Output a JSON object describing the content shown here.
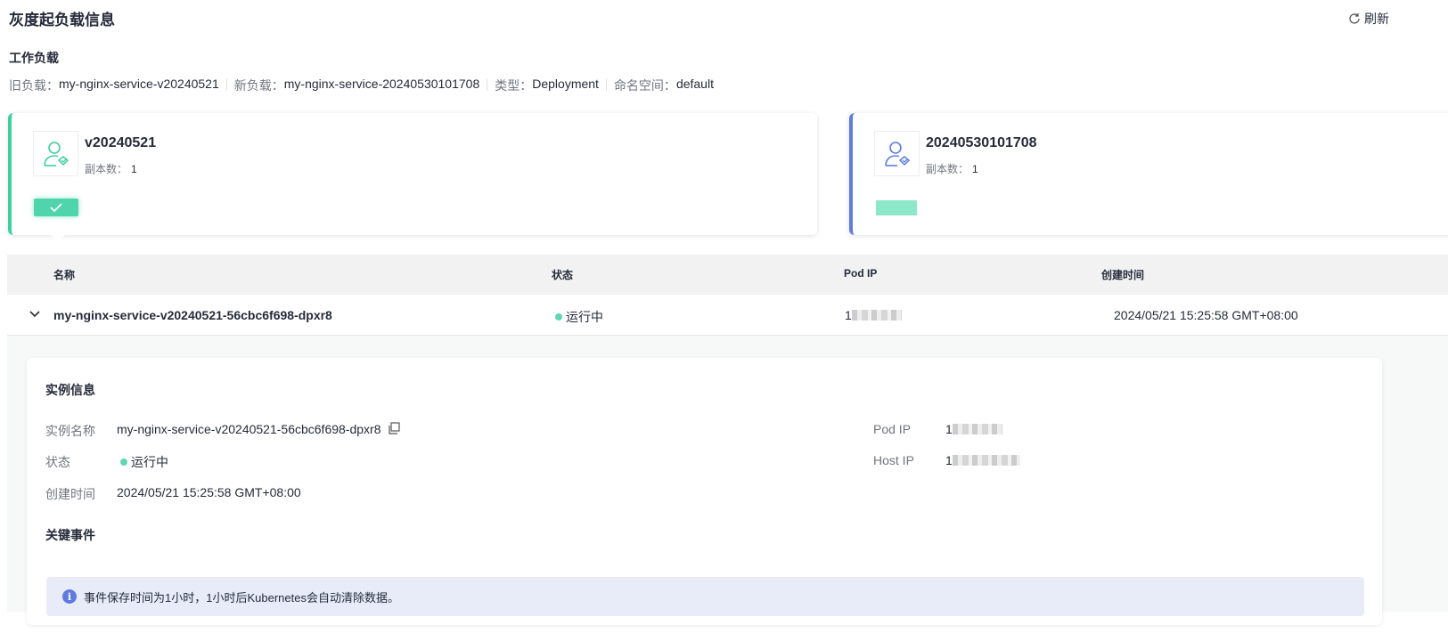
{
  "title": "灰度起负载信息",
  "refresh_label": "刷新",
  "workload": {
    "heading": "工作负载",
    "old_label": "旧负载：",
    "old_value": "my-nginx-service-v20240521",
    "new_label": "新负载：",
    "new_value": "my-nginx-service-20240530101708",
    "type_label": "类型：",
    "type_value": "Deployment",
    "ns_label": "命名空间：",
    "ns_value": "default"
  },
  "cards": [
    {
      "name": "v20240521",
      "replicas_label": "副本数：",
      "replicas": "1",
      "color": "#3ecfa0"
    },
    {
      "name": "20240530101708",
      "replicas_label": "副本数：",
      "replicas": "1",
      "color": "#5e7ce0"
    }
  ],
  "table": {
    "headers": [
      "名称",
      "状态",
      "Pod IP",
      "创建时间"
    ],
    "rows": [
      {
        "name": "my-nginx-service-v20240521-56cbc6f698-dpxr8",
        "status": "运行中",
        "pod_ip": "1",
        "created": "2024/05/21 15:25:58 GMT+08:00"
      }
    ]
  },
  "detail": {
    "heading": "实例信息",
    "name_label": "实例名称",
    "name_value": "my-nginx-service-v20240521-56cbc6f698-dpxr8",
    "status_label": "状态",
    "status_value": "运行中",
    "created_label": "创建时间",
    "created_value": "2024/05/21 15:25:58 GMT+08:00",
    "podip_label": "Pod IP",
    "podip_value": "1",
    "hostip_label": "Host IP",
    "hostip_value": "1",
    "events_heading": "关键事件",
    "notice": "事件保存时间为1小时，1小时后Kubernetes会自动清除数据。"
  }
}
